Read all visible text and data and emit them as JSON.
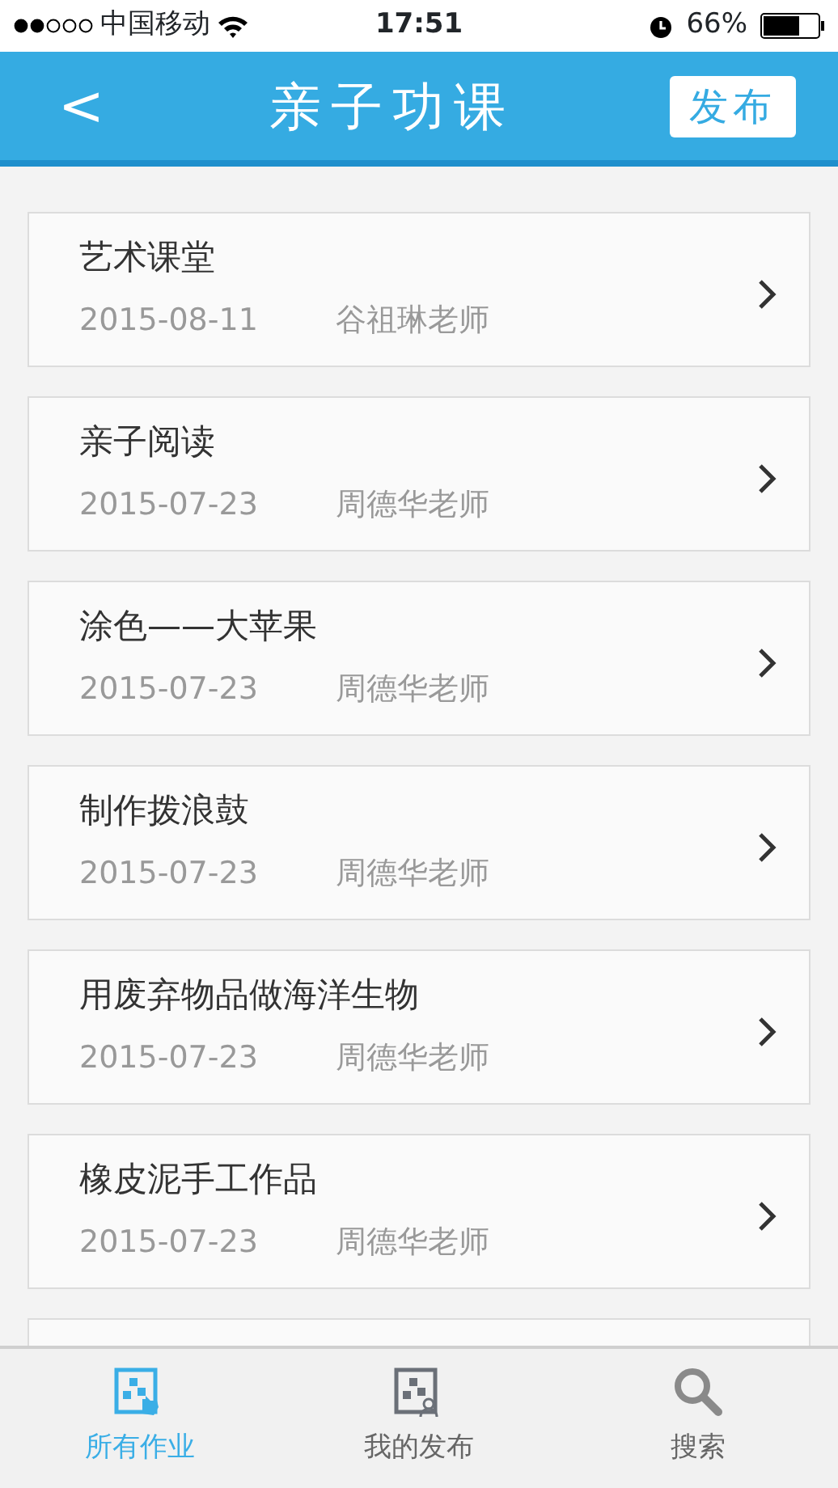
{
  "status_bar": {
    "carrier": "中国移动",
    "time": "17:51",
    "battery": "66%"
  },
  "header": {
    "back": "<",
    "title": "亲子功课",
    "action": "发布"
  },
  "lessons": [
    {
      "title": "艺术课堂",
      "date": "2015-08-11",
      "teacher": "谷祖琳老师"
    },
    {
      "title": "亲子阅读",
      "date": "2015-07-23",
      "teacher": "周德华老师"
    },
    {
      "title": "涂色——大苹果",
      "date": "2015-07-23",
      "teacher": "周德华老师"
    },
    {
      "title": "制作拨浪鼓",
      "date": "2015-07-23",
      "teacher": "周德华老师"
    },
    {
      "title": "用废弃物品做海洋生物",
      "date": "2015-07-23",
      "teacher": "周德华老师"
    },
    {
      "title": "橡皮泥手工作品",
      "date": "2015-07-23",
      "teacher": "周德华老师"
    }
  ],
  "more_below": true,
  "tabs": [
    {
      "label": "所有作业",
      "kind": "all",
      "selected": true
    },
    {
      "label": "我的发布",
      "kind": "mine",
      "selected": false
    },
    {
      "label": "搜索",
      "kind": "search",
      "selected": false
    }
  ]
}
